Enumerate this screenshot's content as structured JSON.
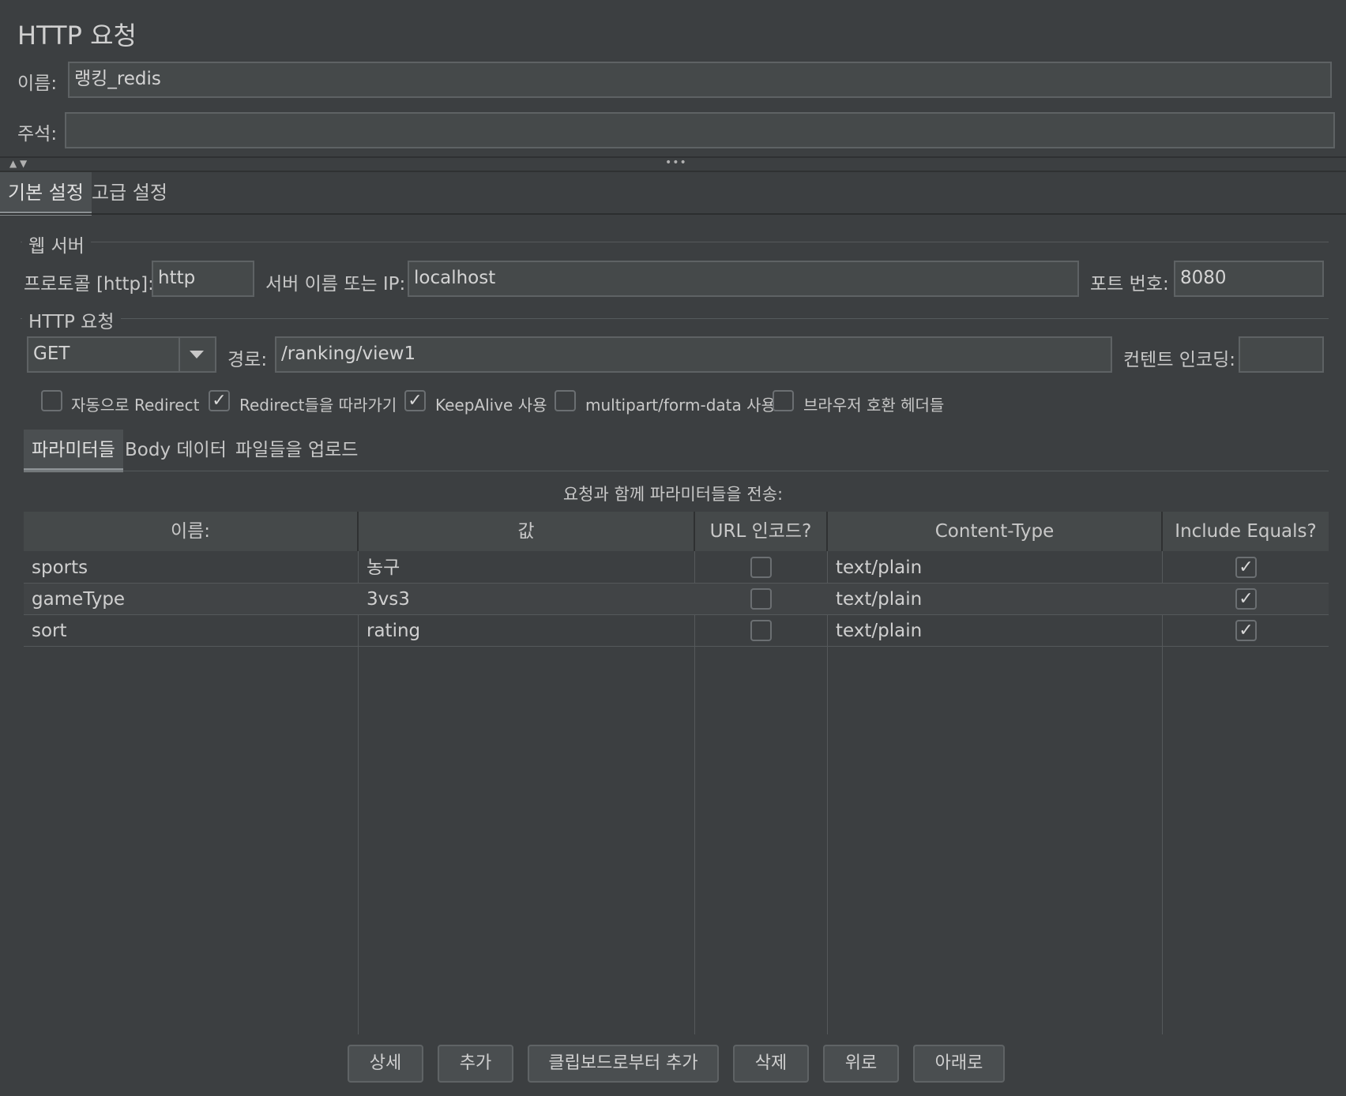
{
  "header": {
    "title": "HTTP 요청",
    "name_label": "이름:",
    "name_value": "랭킹_redis",
    "comment_label": "주석:",
    "comment_value": ""
  },
  "splitter": {
    "arrows": "▲ ▼",
    "dots": "•••"
  },
  "main_tabs": [
    {
      "label": "기본 설정",
      "active": true
    },
    {
      "label": "고급 설정",
      "active": false
    }
  ],
  "web_server": {
    "group_title": "웹 서버",
    "protocol_label": "프로토콜 [http]:",
    "protocol_value": "http",
    "server_label": "서버 이름 또는 IP:",
    "server_value": "localhost",
    "port_label": "포트 번호:",
    "port_value": "8080"
  },
  "http_request": {
    "group_title": "HTTP 요청",
    "method": "GET",
    "path_label": "경로:",
    "path_value": "/ranking/view1",
    "encoding_label": "컨텐트 인코딩:",
    "encoding_value": ""
  },
  "options": [
    {
      "label": "자동으로 Redirect",
      "checked": false
    },
    {
      "label": "Redirect들을 따라가기",
      "checked": true
    },
    {
      "label": "KeepAlive 사용",
      "checked": true
    },
    {
      "label": "multipart/form-data 사용",
      "checked": false
    },
    {
      "label": "브라우저 호환 헤더들",
      "checked": false
    }
  ],
  "sub_tabs": [
    {
      "label": "파라미터들",
      "active": true
    },
    {
      "label": "Body 데이터",
      "active": false
    },
    {
      "label": "파일들을 업로드",
      "active": false
    }
  ],
  "params": {
    "caption": "요청과 함께 파라미터들을 전송:",
    "columns": [
      "이름:",
      "값",
      "URL 인코드?",
      "Content-Type",
      "Include Equals?"
    ],
    "rows": [
      {
        "name": "sports",
        "value": "농구",
        "url_encode": false,
        "content_type": "text/plain",
        "include_equals": true
      },
      {
        "name": "gameType",
        "value": "3vs3",
        "url_encode": false,
        "content_type": "text/plain",
        "include_equals": true
      },
      {
        "name": "sort",
        "value": "rating",
        "url_encode": false,
        "content_type": "text/plain",
        "include_equals": true
      }
    ]
  },
  "buttons": [
    "상세",
    "추가",
    "클립보드로부터 추가",
    "삭제",
    "위로",
    "아래로"
  ],
  "check_glyph": "✓",
  "colors": {
    "background": "#3c3f41",
    "field": "#45494a",
    "border": "#5e6264"
  }
}
